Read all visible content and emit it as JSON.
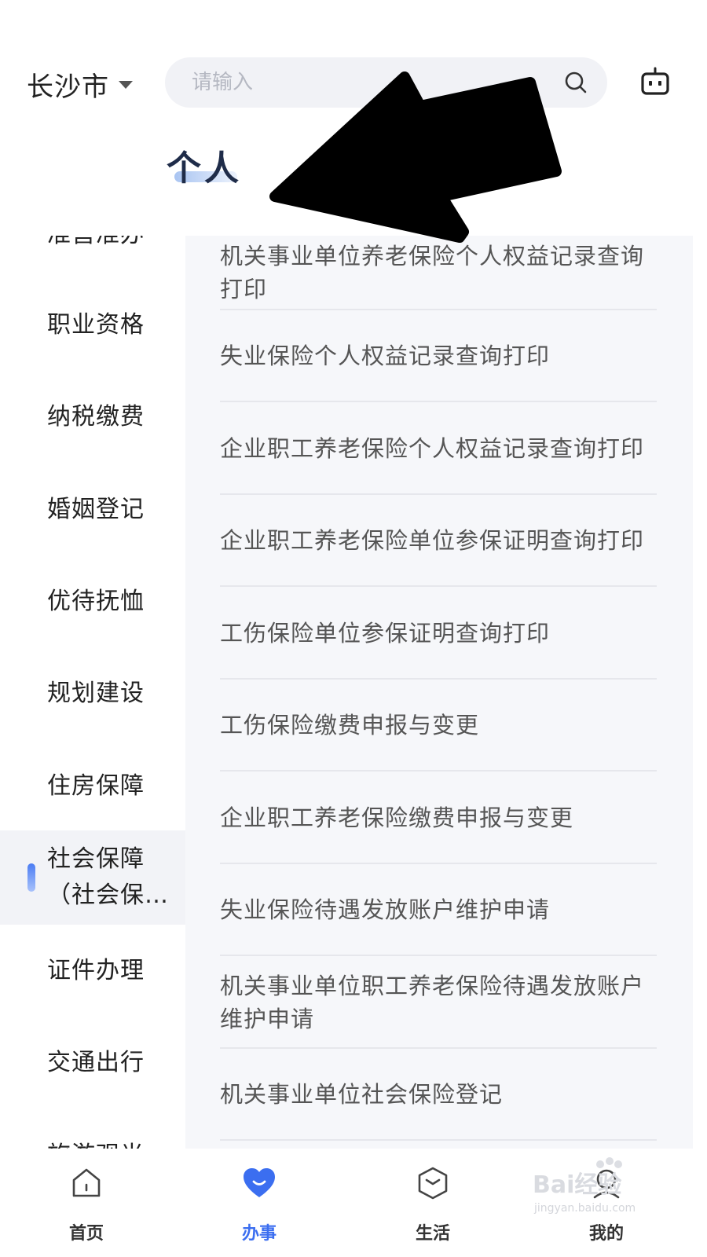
{
  "header": {
    "city": "长沙市",
    "search_placeholder": "请输入",
    "section_title": "个人"
  },
  "sidebar": {
    "items": [
      {
        "label": "准营准办",
        "state": "partially-visible-top"
      },
      {
        "label": "职业资格"
      },
      {
        "label": "纳税缴费"
      },
      {
        "label": "婚姻登记"
      },
      {
        "label": "优待抚恤"
      },
      {
        "label": "规划建设"
      },
      {
        "label": "住房保障"
      },
      {
        "label": "社会保障\n（社会保…",
        "active": true
      },
      {
        "label": "证件办理"
      },
      {
        "label": "交通出行"
      },
      {
        "label": "旅游观光",
        "state": "partially-visible-bottom"
      }
    ]
  },
  "services": [
    "机关事业单位养老保险个人权益记录查询打印",
    "失业保险个人权益记录查询打印",
    "企业职工养老保险个人权益记录查询打印",
    "企业职工养老保险单位参保证明查询打印",
    "工伤保险单位参保证明查询打印",
    "工伤保险缴费申报与变更",
    "企业职工养老保险缴费申报与变更",
    "失业保险待遇发放账户维护申请",
    "机关事业单位职工养老保险待遇发放账户维护申请",
    "机关事业单位社会保险登记"
  ],
  "bottom_nav": {
    "items": [
      {
        "label": "首页",
        "icon": "home-icon"
      },
      {
        "label": "办事",
        "icon": "heart-icon",
        "active": true
      },
      {
        "label": "生活",
        "icon": "cube-icon"
      },
      {
        "label": "我的",
        "icon": "profile-icon"
      }
    ]
  },
  "watermark": {
    "brand": "Bai经验",
    "url": "jingyan.baidu.com"
  },
  "colors": {
    "accent": "#3b6ef0",
    "list_bg": "#f6f7fa",
    "active_cat_bg": "#f2f3f7",
    "title": "#1f2c49"
  }
}
